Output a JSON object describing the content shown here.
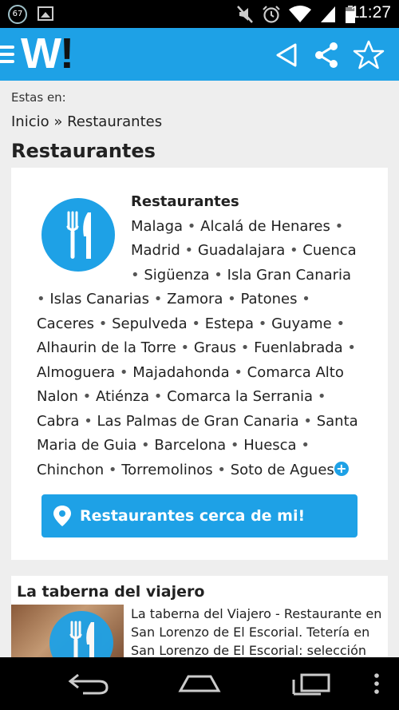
{
  "status_bar": {
    "notification_count": "67",
    "time": "11:27"
  },
  "app_bar": {
    "logo_text": "W",
    "logo_bang": "!",
    "icons": [
      "menu-icon",
      "back-triangle-icon",
      "share-icon",
      "star-icon"
    ]
  },
  "breadcrumb": {
    "prefix": "Estas en:",
    "trail": "Inicio » Restaurantes"
  },
  "page_title": "Restaurantes",
  "category_card": {
    "title": "Restaurantes",
    "cities": [
      "Malaga",
      "Alcalá de Henares",
      "Madrid",
      "Guadalajara",
      "Cuenca",
      "Sigüenza",
      "Isla Gran Canaria",
      "Islas Canarias",
      "Zamora",
      "Patones",
      "Caceres",
      "Sepulveda",
      "Estepa",
      "Guyame",
      "Alhaurin de la Torre",
      "Graus",
      "Fuenlabrada",
      "Almoguera",
      "Majadahonda",
      "Comarca Alto Nalon",
      "Atiénza",
      "Comarca la Serrania",
      "Cabra",
      "Las Palmas de Gran Canaria",
      "Santa Maria de Guia",
      "Barcelona",
      "Huesca",
      "Chinchon",
      "Torremolinos",
      "Soto de Agues"
    ],
    "more_symbol": "+",
    "nearby_button": "Restaurantes cerca de mi!"
  },
  "listing": {
    "title": "La taberna del viajero",
    "description": "La taberna del Viajero - Restaurante en San Lorenzo de El Escorial. Tetería en San Lorenzo de El Escorial: selección"
  },
  "colors": {
    "accent": "#1ea1e6",
    "status_bar": "#000000",
    "background": "#eeeeee"
  }
}
